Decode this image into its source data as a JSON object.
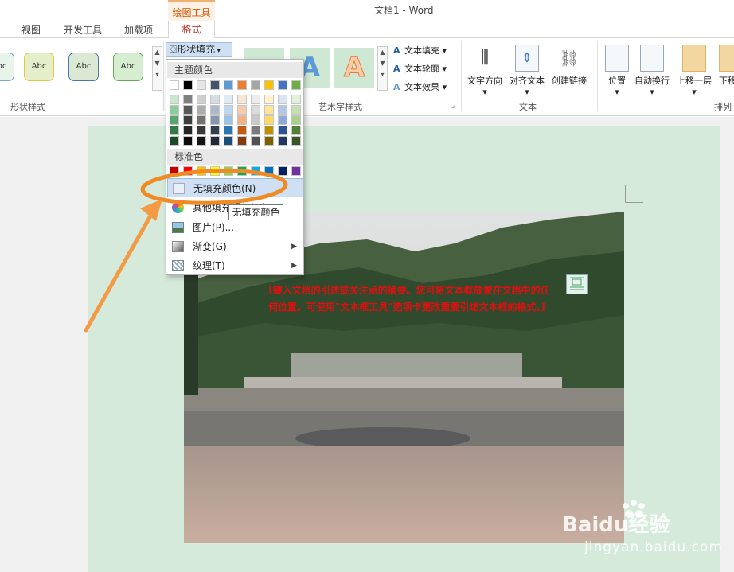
{
  "window": {
    "title": "文档1 - Word",
    "context_tab_group": "绘图工具"
  },
  "tabs": [
    {
      "label": "视图"
    },
    {
      "label": "开发工具"
    },
    {
      "label": "加载项"
    },
    {
      "label": "格式",
      "active": true
    }
  ],
  "ribbon": {
    "shape_styles": {
      "group_label": "形状样式",
      "thumb_label": "Abc"
    },
    "shape_fill_button": "形状填充",
    "wordart": {
      "group_label": "艺术字样式",
      "tile_glyph": "A",
      "text_fill": "文本填充",
      "text_outline": "文本轮廓",
      "text_effects": "文本效果"
    },
    "text_group": {
      "group_label": "文本",
      "direction": "文字方向",
      "align": "对齐文本",
      "link": "创建链接"
    },
    "arrange_group": {
      "group_label": "排列",
      "position": "位置",
      "wrap": "自动换行",
      "bring_forward": "上移一层",
      "send_backward": "下移"
    }
  },
  "dropdown": {
    "theme_colors_header": "主题颜色",
    "theme_colors": [
      "#ffffff",
      "#000000",
      "#e7e6e6",
      "#44546a",
      "#5b9bd5",
      "#ed7d31",
      "#a5a5a5",
      "#ffc000",
      "#4472c4",
      "#70ad47"
    ],
    "theme_shades": [
      [
        "#c9e6cf",
        "#7f7f7f",
        "#d0cece",
        "#d6dce4",
        "#deebf6",
        "#fbe5d5",
        "#ededed",
        "#fff2cc",
        "#dae3f3",
        "#e2efd9"
      ],
      [
        "#8ccc9a",
        "#595959",
        "#aeabab",
        "#adb9ca",
        "#bdd7ee",
        "#f7cbac",
        "#dbdbdb",
        "#fee599",
        "#b4c6e7",
        "#c5e0b3"
      ],
      [
        "#58a66b",
        "#3f3f3f",
        "#757070",
        "#8496b0",
        "#9cc3e5",
        "#f4b183",
        "#c9c9c9",
        "#ffd965",
        "#8eaadb",
        "#a8d08d"
      ],
      [
        "#347a46",
        "#262626",
        "#3a3838",
        "#323f4f",
        "#2e75b5",
        "#c55a11",
        "#7b7b7b",
        "#bf9000",
        "#2f5496",
        "#538135"
      ],
      [
        "#1e4a2a",
        "#0c0c0c",
        "#171616",
        "#222a35",
        "#1e4e79",
        "#833c0b",
        "#525252",
        "#7f6000",
        "#1f3864",
        "#375623"
      ]
    ],
    "standard_colors_header": "标准色",
    "standard_colors": [
      "#c00000",
      "#ff0000",
      "#ffc000",
      "#ffff00",
      "#92d050",
      "#00b050",
      "#00b0f0",
      "#0070c0",
      "#002060",
      "#7030a0"
    ],
    "items": [
      {
        "label": "无填充颜色(N)",
        "icon": "no-fill-icon",
        "highlighted": true
      },
      {
        "label": "其他填充颜色(M)...",
        "icon": "color-wheel-icon"
      },
      {
        "label": "图片(P)...",
        "icon": "picture-icon"
      },
      {
        "label": "渐变(G)",
        "icon": "gradient-icon",
        "submenu": true
      },
      {
        "label": "纹理(T)",
        "icon": "texture-icon",
        "submenu": true
      }
    ]
  },
  "tooltip": "无填充颜色",
  "document": {
    "textbox_text": "[键入文档的引述或关注点的摘要。您可将文本框放置在文档中的任何位置。可使用\"文本框工具\"选项卡更改重要引述文本框的格式。]"
  },
  "annotation": {
    "circle_color": "#f08a24",
    "arrow_color": "#f39a45"
  },
  "watermark": {
    "brand": "Baidu经验",
    "url": "jingyan.baidu.com"
  }
}
